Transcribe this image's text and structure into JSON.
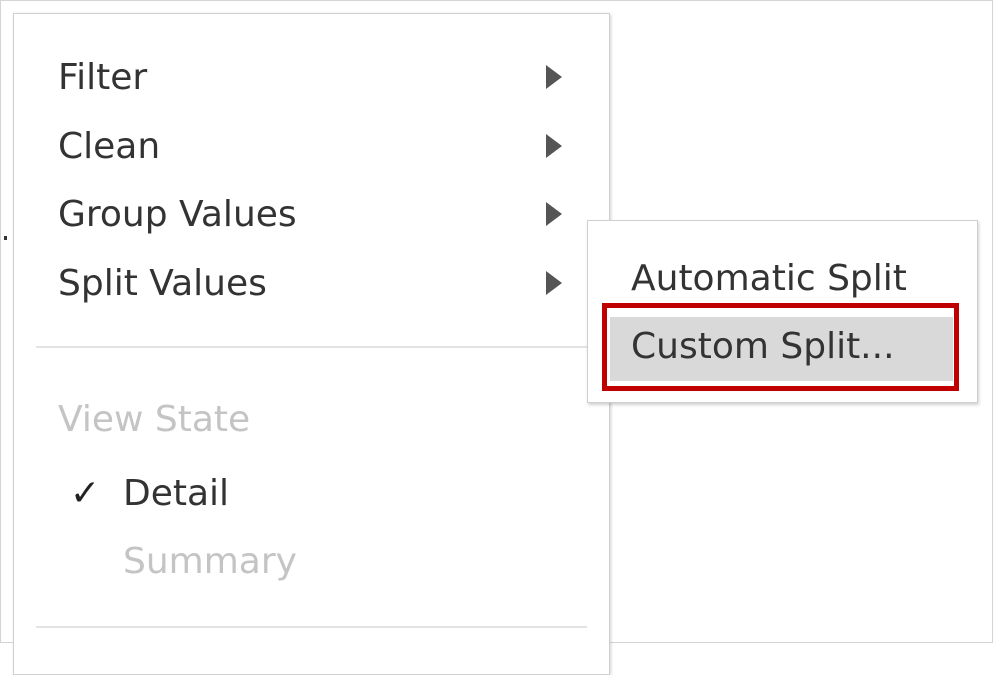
{
  "menu": {
    "items": [
      {
        "label": "Filter",
        "has_submenu": true
      },
      {
        "label": "Clean",
        "has_submenu": true
      },
      {
        "label": "Group Values",
        "has_submenu": true
      },
      {
        "label": "Split Values",
        "has_submenu": true
      }
    ],
    "view_state": {
      "title": "View State",
      "options": [
        {
          "label": "Detail",
          "checked": true,
          "enabled": true
        },
        {
          "label": "Summary",
          "checked": false,
          "enabled": false
        }
      ]
    }
  },
  "submenu": {
    "items": [
      {
        "label": "Automatic Split"
      },
      {
        "label": "Custom Split...",
        "highlighted": true
      }
    ]
  },
  "colors": {
    "highlight_outline": "#c00000",
    "hover_background": "#d9d9d9",
    "disabled_text": "#c4c4c4"
  },
  "icons": {
    "submenu_arrow": "triangle-right",
    "checkmark": "✓"
  }
}
